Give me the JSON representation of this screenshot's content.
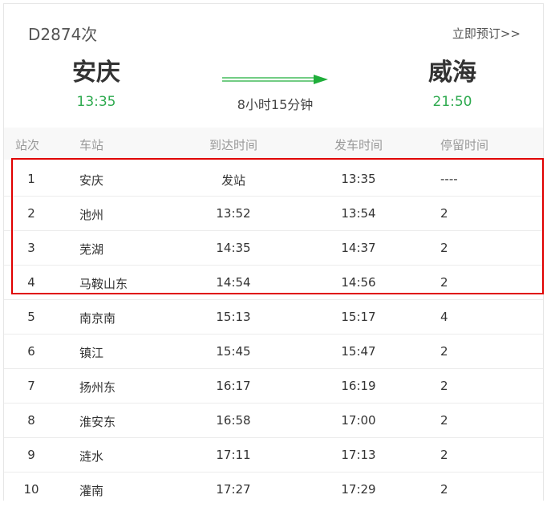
{
  "train": {
    "number": "D2874次",
    "book_label": "立即预订>>"
  },
  "route": {
    "from_station": "安庆",
    "from_time": "13:35",
    "to_station": "威海",
    "to_time": "21:50",
    "duration": "8小时15分钟"
  },
  "colors": {
    "time_green": "#2eaa4f",
    "arrow_green": "#1fae3a",
    "highlight_red": "#e00000"
  },
  "icons": {
    "direction_arrow": "right-arrow-icon"
  },
  "table": {
    "headers": {
      "seq": "站次",
      "name": "车站",
      "arrive": "到达时间",
      "depart": "发车时间",
      "stay": "停留时间"
    },
    "rows": [
      {
        "seq": "1",
        "name": "安庆",
        "arrive": "发站",
        "depart": "13:35",
        "stay": "----"
      },
      {
        "seq": "2",
        "name": "池州",
        "arrive": "13:52",
        "depart": "13:54",
        "stay": "2"
      },
      {
        "seq": "3",
        "name": "芜湖",
        "arrive": "14:35",
        "depart": "14:37",
        "stay": "2"
      },
      {
        "seq": "4",
        "name": "马鞍山东",
        "arrive": "14:54",
        "depart": "14:56",
        "stay": "2"
      },
      {
        "seq": "5",
        "name": "南京南",
        "arrive": "15:13",
        "depart": "15:17",
        "stay": "4"
      },
      {
        "seq": "6",
        "name": "镇江",
        "arrive": "15:45",
        "depart": "15:47",
        "stay": "2"
      },
      {
        "seq": "7",
        "name": "扬州东",
        "arrive": "16:17",
        "depart": "16:19",
        "stay": "2"
      },
      {
        "seq": "8",
        "name": "淮安东",
        "arrive": "16:58",
        "depart": "17:00",
        "stay": "2"
      },
      {
        "seq": "9",
        "name": "涟水",
        "arrive": "17:11",
        "depart": "17:13",
        "stay": "2"
      },
      {
        "seq": "10",
        "name": "灌南",
        "arrive": "17:27",
        "depart": "17:29",
        "stay": "2"
      }
    ]
  }
}
